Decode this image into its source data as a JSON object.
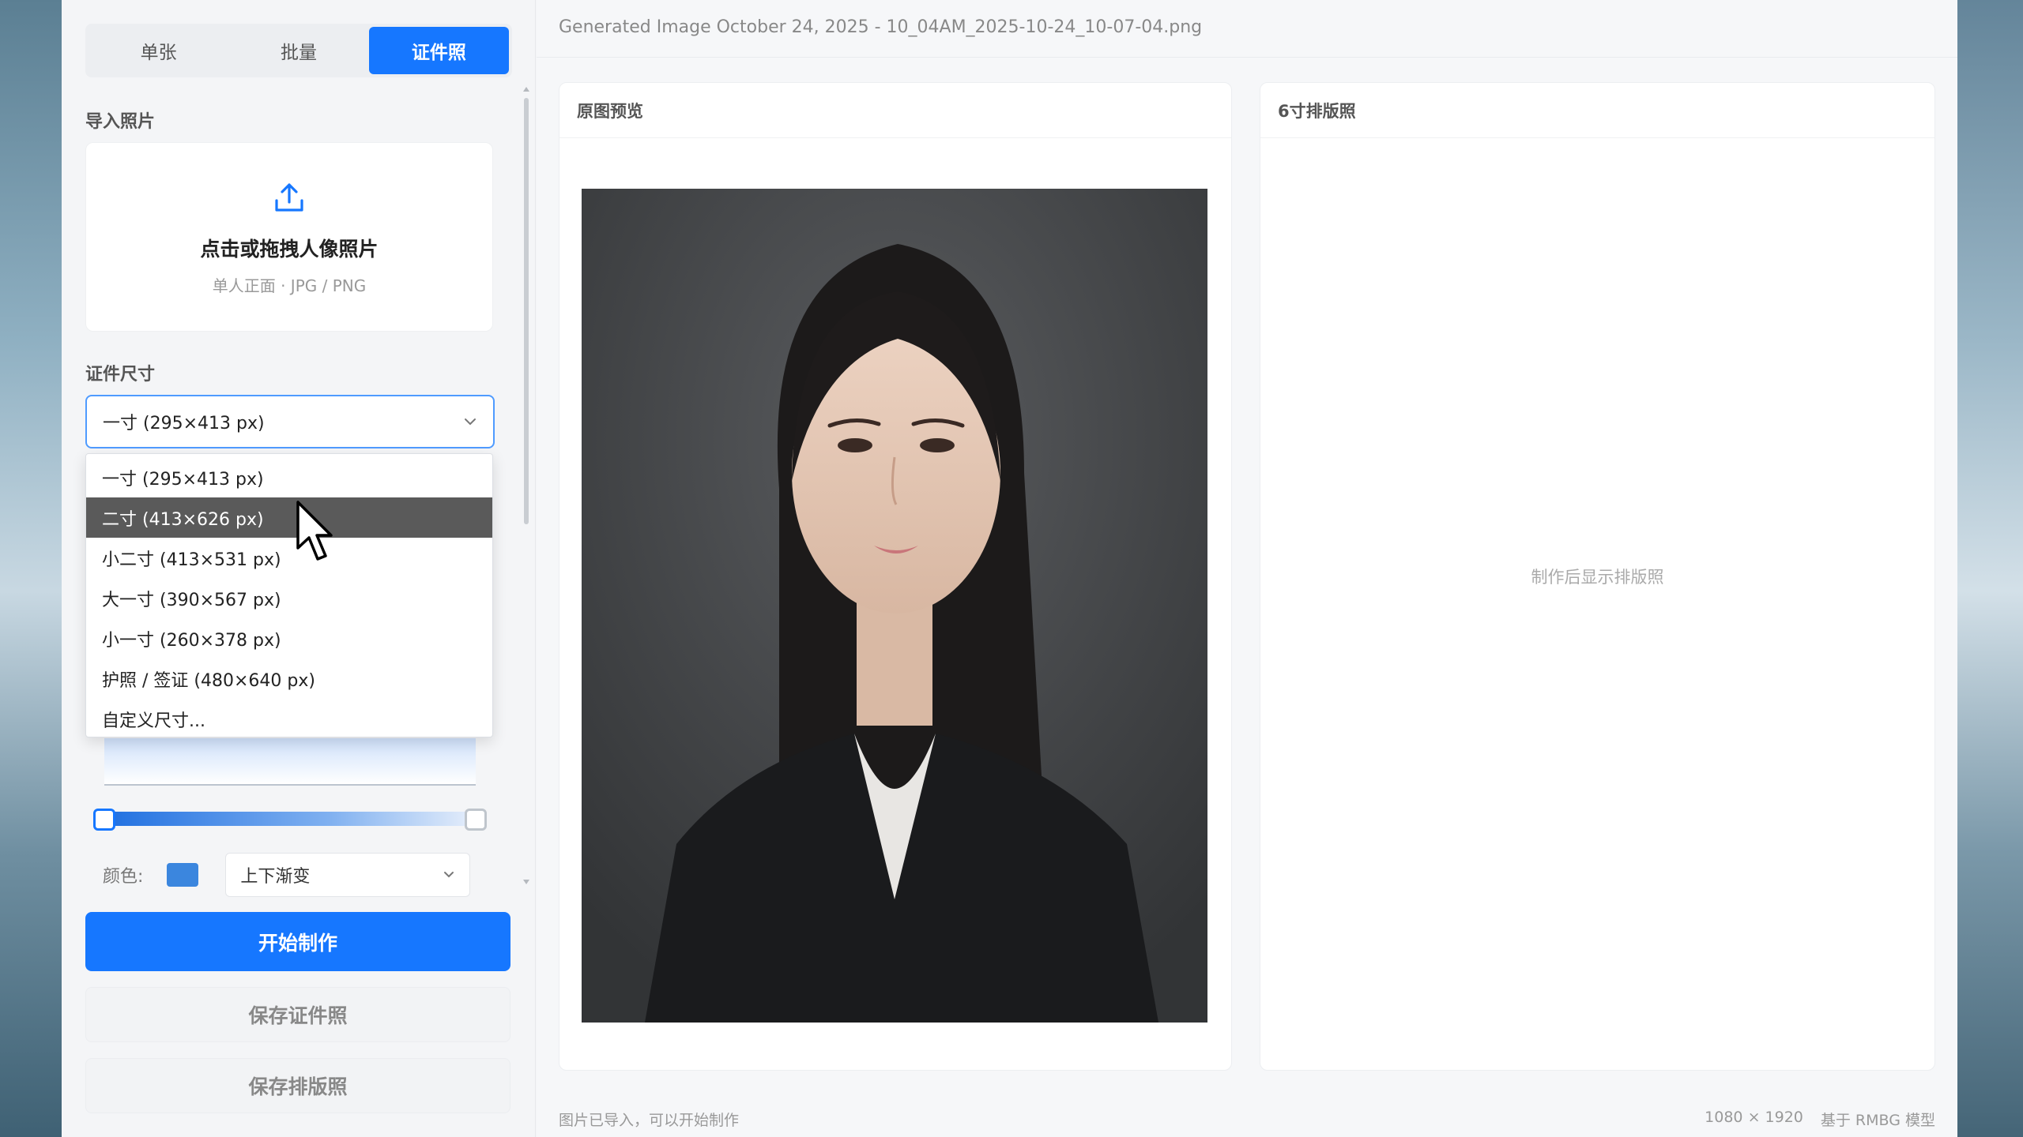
{
  "tabs": [
    {
      "label": "单张",
      "active": false
    },
    {
      "label": "批量",
      "active": false
    },
    {
      "label": "证件照",
      "active": true
    }
  ],
  "import": {
    "label": "导入照片",
    "main_text": "点击或拖拽人像照片",
    "sub_text": "单人正面 · JPG / PNG",
    "icon": "upload-icon"
  },
  "size": {
    "label": "证件尺寸",
    "selected": "一寸 (295×413 px)",
    "options": [
      "一寸 (295×413 px)",
      "二寸 (413×626 px)",
      "小二寸 (413×531 px)",
      "大一寸 (390×567 px)",
      "小一寸 (260×378 px)",
      "护照 / 签证 (480×640 px)",
      "自定义尺寸..."
    ],
    "hovered_option": "二寸 (413×626 px)"
  },
  "background": {
    "color_label": "颜色:",
    "color_value": "#3b86de",
    "gradient_mode": "上下渐变"
  },
  "actions": {
    "start": "开始制作",
    "save_id": "保存证件照",
    "save_layout": "保存排版照"
  },
  "main": {
    "file_title": "Generated Image October 24, 2025 - 10_04AM_2025-10-24_10-07-04.png",
    "original_panel": "原图预览",
    "layout_panel": "6寸排版照",
    "layout_placeholder": "制作后显示排版照"
  },
  "status": {
    "message": "图片已导入，可以开始制作",
    "dimensions": "1080 × 1920",
    "model": "基于 RMBG 模型"
  },
  "colors": {
    "accent": "#1677ff",
    "hover_bg": "#5a5a5a"
  }
}
